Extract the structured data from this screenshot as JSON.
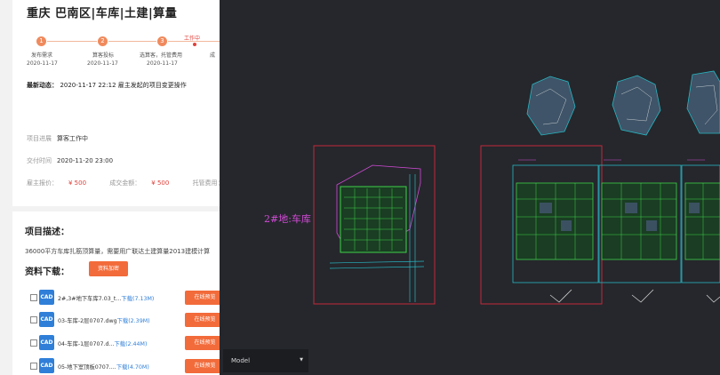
{
  "project": {
    "title": "重庆 巴南区|车库|土建|算量",
    "steps": [
      {
        "num": "1",
        "label": "发布需求",
        "date": "2020-11-17"
      },
      {
        "num": "2",
        "label": "算客投标",
        "date": "2020-11-17"
      },
      {
        "num": "3",
        "label": "选算客，托管费用",
        "date": "2020-11-17"
      }
    ],
    "current_step_label": "工作中",
    "truncated_step_label": "成",
    "recent_label": "最新动态：",
    "recent_value": "2020-11-17 22:12 雇主发起的项目变更操作",
    "progress_label": "项目进展",
    "progress_value": "算客工作中",
    "deadline_label": "交付时间",
    "deadline_value": "2020-11-20 23:00",
    "employer_price_label": "雇主报价：",
    "employer_price_value": "¥ 500",
    "deal_price_label": "成交金额：",
    "deal_price_value": "¥ 500",
    "escrow_label": "托管费用：",
    "escrow_value": "¥"
  },
  "description": {
    "title": "项目描述：",
    "text": "36000平方车库扎筋顶算量，需要用广联达土建算量2013建模计算"
  },
  "downloads": {
    "title": "资料下载：",
    "pay_button": "资料加密",
    "files": [
      {
        "icon": "CAD",
        "name": "2#,3#地下车库7.03_t...",
        "link": "下载(7.13M)",
        "preview": "在线预览"
      },
      {
        "icon": "CAD",
        "name": "03-车库-2层0707.dwg",
        "link": "下载(2.39M)",
        "preview": "在线预览"
      },
      {
        "icon": "CAD",
        "name": "04-车库-1层0707.d...",
        "link": "下载(2.44M)",
        "preview": "在线预览"
      },
      {
        "icon": "CAD",
        "name": "05-地下室顶板0707....",
        "link": "下载(4.70M)",
        "preview": "在线预览"
      }
    ]
  },
  "viewer": {
    "drawing_label": "2#地:车库",
    "model_select": "Model",
    "colors": {
      "background": "#25272c",
      "frame": "#c3283a",
      "green": "#3fd24a",
      "cyan": "#27b6c2",
      "magenta": "#d24bd6"
    }
  }
}
